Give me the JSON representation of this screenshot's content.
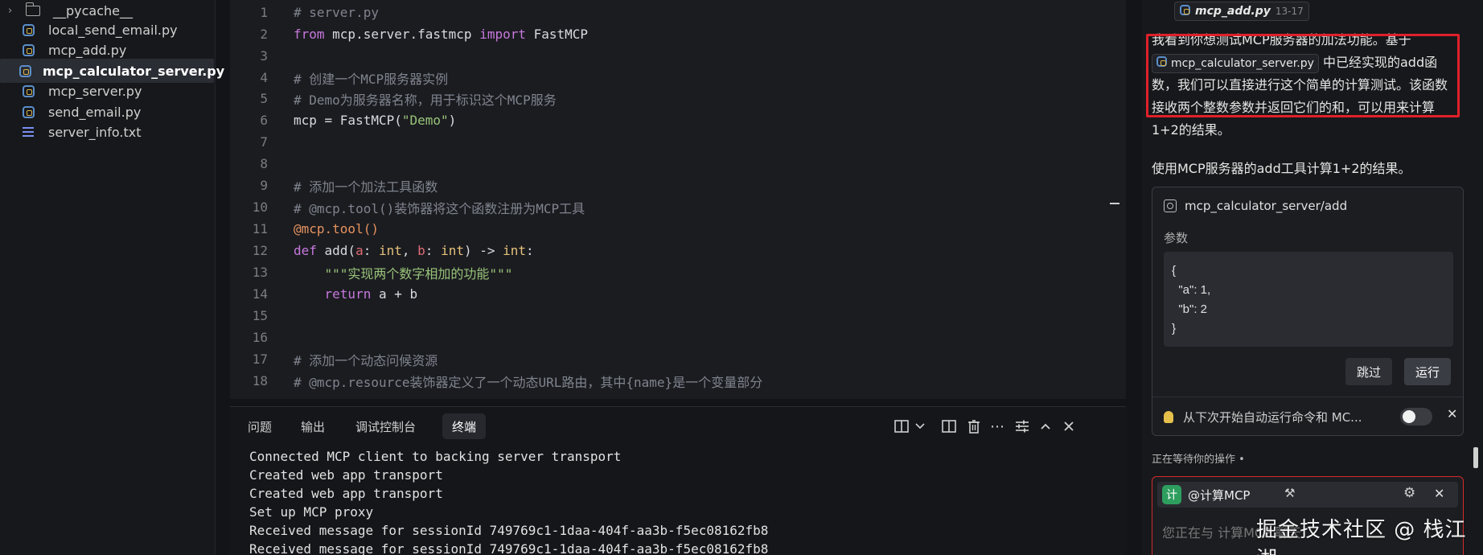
{
  "explorer": {
    "items": [
      {
        "label": "__pycache__",
        "type": "folder"
      },
      {
        "label": "local_send_email.py",
        "type": "py"
      },
      {
        "label": "mcp_add.py",
        "type": "py"
      },
      {
        "label": "mcp_calculator_server.py",
        "type": "py",
        "active": true
      },
      {
        "label": "mcp_server.py",
        "type": "py"
      },
      {
        "label": "send_email.py",
        "type": "py"
      },
      {
        "label": "server_info.txt",
        "type": "txt"
      }
    ]
  },
  "editor": {
    "line_numbers": [
      "1",
      "2",
      "3",
      "4",
      "5",
      "6",
      "7",
      "8",
      "9",
      "10",
      "11",
      "12",
      "13",
      "14",
      "15",
      "16",
      "17",
      "18"
    ],
    "lines": {
      "l1": "# server.py",
      "l2_kw1": "from",
      "l2_mod": " mcp.server.fastmcp ",
      "l2_kw2": "import",
      "l2_name": " FastMCP",
      "l4": "# 创建一个MCP服务器实例",
      "l5": "# Demo为服务器名称，用于标识这个MCP服务",
      "l6_a": "mcp = FastMCP(",
      "l6_str": "\"Demo\"",
      "l6_b": ")",
      "l9": "# 添加一个加法工具函数",
      "l10": "# @mcp.tool()装饰器将这个函数注册为MCP工具",
      "l11": "@mcp.tool()",
      "l12_def": "def",
      "l12_fn": " add(",
      "l12_a": "a",
      "l12_c1": ": ",
      "l12_t1": "int",
      "l12_c2": ", ",
      "l12_b": "b",
      "l12_c3": ": ",
      "l12_t2": "int",
      "l12_c4": ") -> ",
      "l12_t3": "int",
      "l12_c5": ":",
      "l13": "    \"\"\"实现两个数字相加的功能\"\"\"",
      "l14_kw": "    return",
      "l14_rest": " a + b",
      "l17": "# 添加一个动态问候资源",
      "l18": "# @mcp.resource装饰器定义了一个动态URL路由，其中{name}是一个变量部分"
    }
  },
  "panel": {
    "tabs": [
      "问题",
      "输出",
      "调试控制台",
      "终端"
    ],
    "active_tab": "终端",
    "terminal_lines": [
      "Connected MCP client to backing server transport",
      "Created web app transport",
      "Created web app transport",
      "Set up MCP proxy",
      "Received message for sessionId 749769c1-1daa-404f-aa3b-f5ec08162fb8",
      "Received message for sessionId 749769c1-1daa-404f-aa3b-f5ec08162fb8"
    ]
  },
  "chat": {
    "ref_file": "mcp_add.py",
    "ref_lines": "13-17",
    "para_start": "我看到你想测试MCP服务器的加法功能。基于",
    "para_chip": "mcp_calculator_server.py",
    "para_end": "中已经实现的add函数，我们可以直接进行这个简单的计算测试。该函数接收两个整数参数并返回它们的和，可以用来计算1+2的结果。",
    "para2": "使用MCP服务器的add工具计算1+2的结果。",
    "tool_card": {
      "title": "mcp_calculator_server/add",
      "params_label": "参数",
      "params_json": "{\n  \"a\": 1,\n  \"b\": 2\n}",
      "skip": "跳过",
      "run": "运行",
      "auto_run_text": "从下次开始自动运行命令和 MC..."
    },
    "waiting": "正在等待你的操作 •",
    "input": {
      "avatar": "计",
      "mcp_name": "@计算MCP",
      "placeholder": "您正在与 计算MCP 聊天"
    }
  },
  "watermark": "掘金技术社区 @ 栈江湖"
}
